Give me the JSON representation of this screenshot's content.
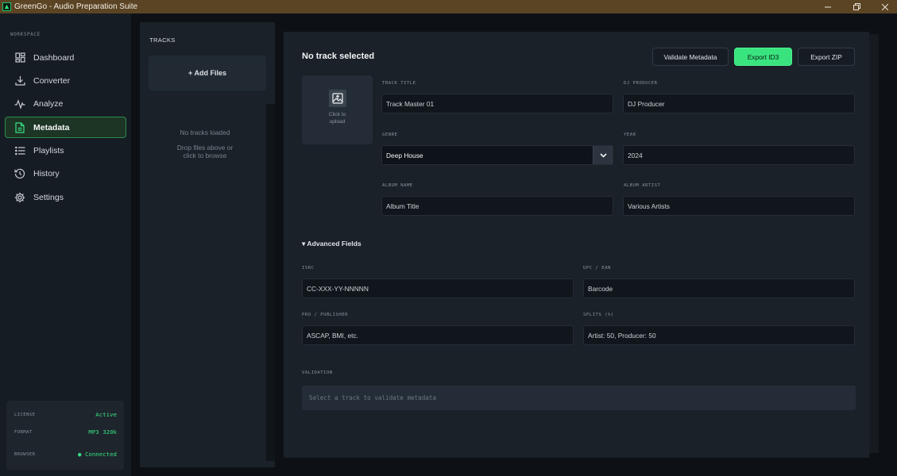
{
  "app": {
    "title": "GreenGo - Audio Preparation Suite",
    "accent_color": "#39e47f",
    "window_controls": [
      "minimize",
      "maximize",
      "close"
    ]
  },
  "sidebar": {
    "section_label": "WORKSPACE",
    "items": [
      {
        "label": "Dashboard",
        "icon": "grid-icon",
        "active": false
      },
      {
        "label": "Converter",
        "icon": "download-icon",
        "active": false
      },
      {
        "label": "Analyze",
        "icon": "waveform-icon",
        "active": false
      },
      {
        "label": "Metadata",
        "icon": "document-icon",
        "active": true
      },
      {
        "label": "Playlists",
        "icon": "list-icon",
        "active": false
      },
      {
        "label": "History",
        "icon": "history-icon",
        "active": false
      },
      {
        "label": "Settings",
        "icon": "gear-icon",
        "active": false
      }
    ],
    "status": {
      "license_label": "LICENSE",
      "license_value": "Active",
      "format_label": "FORMAT",
      "format_value": "MP3 320k",
      "browser_label": "BROWSER",
      "browser_value": "● Connected"
    }
  },
  "tracks": {
    "title": "TRACKS",
    "add_label": "+ Add Files",
    "empty_title": "No tracks loaded",
    "empty_hint": "Drop files above or click to browse"
  },
  "main": {
    "title": "No track selected",
    "buttons": {
      "validate": "Validate Metadata",
      "export_id3": "Export ID3",
      "export_zip": "Export ZIP"
    },
    "upload": {
      "text": "Click to upload",
      "icon": "image-upload-icon"
    },
    "fields": {
      "track_title": {
        "label": "TRACK TITLE",
        "placeholder": "Track Master 01"
      },
      "dj_producer": {
        "label": "DJ PRODUCER",
        "placeholder": "DJ Producer"
      },
      "genre": {
        "label": "GENRE",
        "value": "Deep House"
      },
      "year": {
        "label": "YEAR",
        "placeholder": "2024"
      },
      "album_name": {
        "label": "ALBUM NAME",
        "placeholder": "Album Title"
      },
      "album_artist": {
        "label": "ALBUM ARTIST",
        "placeholder": "Various Artists"
      }
    },
    "advanced": {
      "toggle_label": "▾ Advanced Fields",
      "isrc": {
        "label": "ISRC",
        "placeholder": "CC-XXX-YY-NNNNN"
      },
      "upc": {
        "label": "UPC / EAN",
        "placeholder": "Barcode"
      },
      "pro": {
        "label": "PRO / PUBLISHER",
        "placeholder": "ASCAP, BMI, etc."
      },
      "splits": {
        "label": "SPLITS (%)",
        "placeholder": "Artist: 50, Producer: 50"
      }
    },
    "validation": {
      "label": "VALIDATION",
      "message": "Select a track to validate metadata"
    }
  }
}
